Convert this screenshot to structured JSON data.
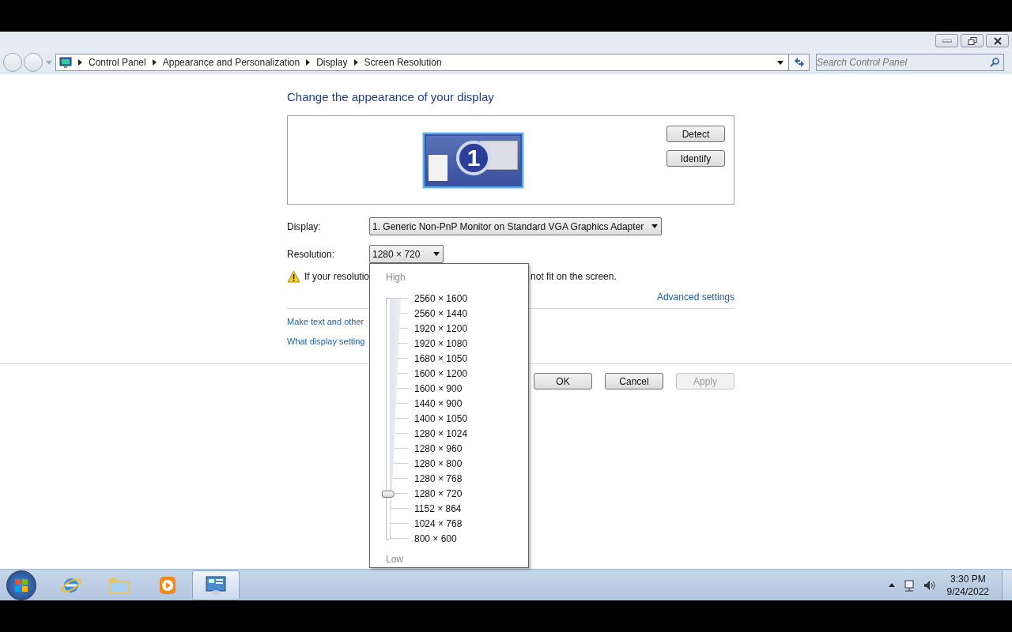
{
  "address_bar": {
    "breadcrumbs": [
      "Control Panel",
      "Appearance and Personalization",
      "Display",
      "Screen Resolution"
    ],
    "search_placeholder": "Search Control Panel"
  },
  "heading": "Change the appearance of your display",
  "monitor": {
    "number": "1",
    "selected": true
  },
  "side_buttons": [
    "Detect",
    "Identify"
  ],
  "display": {
    "label": "Display:",
    "value": "1. Generic Non-PnP Monitor on Standard VGA Graphics Adapter"
  },
  "resolution": {
    "label": "Resolution:",
    "value": "1280 × 720"
  },
  "warning": {
    "left": "If your resolutio",
    "right": "not fit on the screen."
  },
  "advanced_link": "Advanced settings",
  "links": [
    "Make text and other",
    "What display setting"
  ],
  "footer_buttons": [
    {
      "label": "OK",
      "disabled": false
    },
    {
      "label": "Cancel",
      "disabled": false
    },
    {
      "label": "Apply",
      "disabled": true
    }
  ],
  "resolution_popup": {
    "high_label": "High",
    "low_label": "Low",
    "level": 0.1875,
    "options": [
      "2560 × 1600",
      "2560 × 1440",
      "1920 × 1200",
      "1920 × 1080",
      "1680 × 1050",
      "1600 × 1200",
      "1600 × 900",
      "1440 × 900",
      "1400 × 1050",
      "1280 × 1024",
      "1280 × 960",
      "1280 × 800",
      "1280 × 768",
      "1280 × 720",
      "1152 × 864",
      "1024 × 768",
      "800 × 600"
    ]
  },
  "taskbar": {
    "items": [
      {
        "kind": "ie",
        "selected": false
      },
      {
        "kind": "folder",
        "selected": false
      },
      {
        "kind": "media",
        "selected": false
      },
      {
        "kind": "control",
        "selected": true
      }
    ],
    "time": "3:30 PM",
    "date": "9/24/2022"
  }
}
